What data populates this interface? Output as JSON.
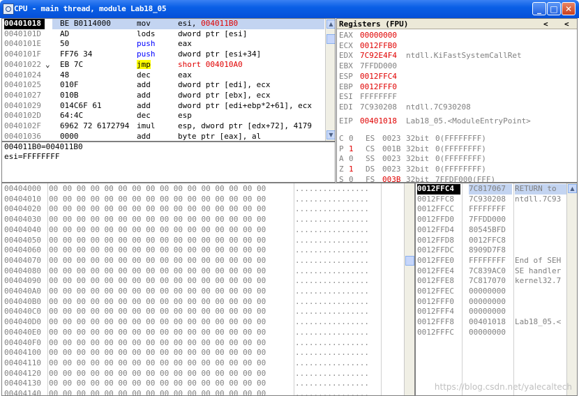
{
  "window": {
    "title": "CPU - main thread, module Lab18_05",
    "buttons": {
      "minimize": "_",
      "maximize": "□",
      "close": "✕"
    }
  },
  "disasm": {
    "rows": [
      {
        "addr": "00401018",
        "hex": "BE B0114000",
        "mnem": "mov",
        "ops": "esi, ",
        "ops_red": "004011B0",
        "selected": true
      },
      {
        "addr": "0040101D",
        "hex": "AD",
        "mnem": "lods",
        "ops": "dword ptr [esi]"
      },
      {
        "addr": "0040101E",
        "hex": "50",
        "mnem": "push",
        "ops": "eax",
        "mnem_color": "blue"
      },
      {
        "addr": "0040101F",
        "hex": "FF76 34",
        "mnem": "push",
        "ops": "dword ptr [esi+34]",
        "mnem_color": "blue"
      },
      {
        "addr": "00401022",
        "marker": "⌄",
        "hex": "EB 7C",
        "mnem": "jmp",
        "ops": "short 004010A0",
        "mnem_color": "jmp",
        "ops_color": "red"
      },
      {
        "addr": "00401024",
        "hex": "48",
        "mnem": "dec",
        "ops": "eax"
      },
      {
        "addr": "00401025",
        "hex": "010F",
        "mnem": "add",
        "ops": "dword ptr [edi], ecx"
      },
      {
        "addr": "00401027",
        "hex": "010B",
        "mnem": "add",
        "ops": "dword ptr [ebx], ecx"
      },
      {
        "addr": "00401029",
        "hex": "014C6F 61",
        "mnem": "add",
        "ops": "dword ptr [edi+ebp*2+61], ecx"
      },
      {
        "addr": "0040102D",
        "hex": "64:4C",
        "mnem": "dec",
        "ops": "esp"
      },
      {
        "addr": "0040102F",
        "hex": "6962 72 6172794",
        "mnem": "imul",
        "ops": "esp, dword ptr [edx+72], 4179"
      },
      {
        "addr": "00401036",
        "hex": "0000",
        "mnem": "add",
        "ops": "byte ptr [eax], al"
      }
    ]
  },
  "info": {
    "line1": "004011B0=004011B0",
    "line2": "esi=FFFFFFFF"
  },
  "registers": {
    "header": "Registers (FPU)",
    "nav_left": "<",
    "nav_right": "<",
    "regs": [
      {
        "name": "EAX",
        "value": "00000000",
        "changed": true,
        "note": ""
      },
      {
        "name": "ECX",
        "value": "0012FFB0",
        "changed": true,
        "note": ""
      },
      {
        "name": "EDX",
        "value": "7C92E4F4",
        "changed": true,
        "note": "ntdll.KiFastSystemCallRet"
      },
      {
        "name": "EBX",
        "value": "7FFDD000",
        "changed": false,
        "note": ""
      },
      {
        "name": "ESP",
        "value": "0012FFC4",
        "changed": true,
        "note": ""
      },
      {
        "name": "EBP",
        "value": "0012FFF0",
        "changed": true,
        "note": ""
      },
      {
        "name": "ESI",
        "value": "FFFFFFFF",
        "changed": false,
        "note": ""
      },
      {
        "name": "EDI",
        "value": "7C930208",
        "changed": false,
        "note": "ntdll.7C930208"
      }
    ],
    "eip": {
      "name": "EIP",
      "value": "00401018",
      "note": "Lab18_05.<ModuleEntryPoint>"
    },
    "flags": [
      {
        "flag": "C",
        "val": "0",
        "seg": "ES",
        "sel": "0023",
        "bits": "32bit",
        "base": "0(FFFFFFFF)",
        "val_red": false,
        "sel_red": false
      },
      {
        "flag": "P",
        "val": "1",
        "seg": "CS",
        "sel": "001B",
        "bits": "32bit",
        "base": "0(FFFFFFFF)",
        "val_red": true,
        "sel_red": false
      },
      {
        "flag": "A",
        "val": "0",
        "seg": "SS",
        "sel": "0023",
        "bits": "32bit",
        "base": "0(FFFFFFFF)",
        "val_red": false,
        "sel_red": false
      },
      {
        "flag": "Z",
        "val": "1",
        "seg": "DS",
        "sel": "0023",
        "bits": "32bit",
        "base": "0(FFFFFFFF)",
        "val_red": true,
        "sel_red": false
      },
      {
        "flag": "S",
        "val": "0",
        "seg": "FS",
        "sel": "003B",
        "bits": "32bit",
        "base": "7FFDF000(FFF)",
        "val_red": false,
        "sel_red": true
      }
    ]
  },
  "dump": {
    "bytes": "00 00 00 00 00 00 00 00 00 00 00 00 00 00 00 00",
    "ascii": "................",
    "addresses": [
      "00404000",
      "00404010",
      "00404020",
      "00404030",
      "00404040",
      "00404050",
      "00404060",
      "00404070",
      "00404080",
      "00404090",
      "004040A0",
      "004040B0",
      "004040C0",
      "004040D0",
      "004040E0",
      "004040F0",
      "00404100",
      "00404110",
      "00404120",
      "00404130",
      "00404140"
    ]
  },
  "stack": {
    "rows": [
      {
        "addr": "0012FFC4",
        "val": "7C817067",
        "comment": "RETURN to",
        "selected": true
      },
      {
        "addr": "0012FFC8",
        "val": "7C930208",
        "comment": "ntdll.7C93"
      },
      {
        "addr": "0012FFCC",
        "val": "FFFFFFFF",
        "comment": ""
      },
      {
        "addr": "0012FFD0",
        "val": "7FFDD000",
        "comment": ""
      },
      {
        "addr": "0012FFD4",
        "val": "80545BFD",
        "comment": ""
      },
      {
        "addr": "0012FFD8",
        "val": "0012FFC8",
        "comment": ""
      },
      {
        "addr": "0012FFDC",
        "val": "8909D7F8",
        "comment": ""
      },
      {
        "addr": "0012FFE0",
        "val": "FFFFFFFF",
        "comment": "End of SEH"
      },
      {
        "addr": "0012FFE4",
        "val": "7C839AC0",
        "comment": "SE handler"
      },
      {
        "addr": "0012FFE8",
        "val": "7C817070",
        "comment": "kernel32.7"
      },
      {
        "addr": "0012FFEC",
        "val": "00000000",
        "comment": ""
      },
      {
        "addr": "0012FFF0",
        "val": "00000000",
        "comment": ""
      },
      {
        "addr": "0012FFF4",
        "val": "00000000",
        "comment": ""
      },
      {
        "addr": "0012FFF8",
        "val": "00401018",
        "comment": "Lab18_05.<"
      },
      {
        "addr": "0012FFFC",
        "val": "00000000",
        "comment": ""
      }
    ]
  },
  "scroll": {
    "up": "▲",
    "down": "▼"
  },
  "watermark": "https://blog.csdn.net/yalecaltech",
  "colors": {
    "title_bar": "#0a5fe6",
    "selection": "#000080",
    "changed_register": "#e00000",
    "jmp_highlight": "#ffff00",
    "push_text": "#0000ff"
  }
}
